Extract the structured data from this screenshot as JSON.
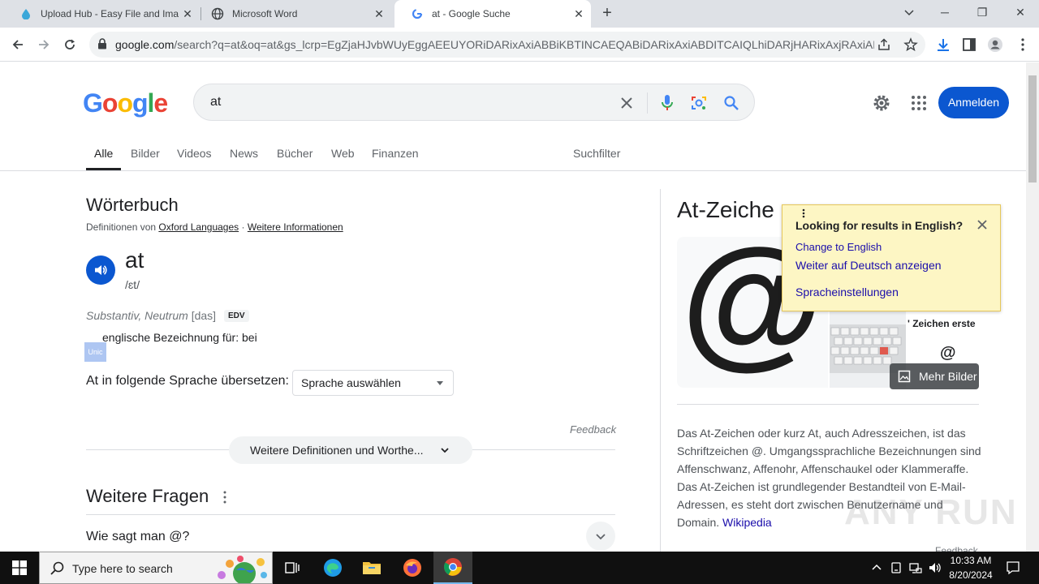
{
  "browser": {
    "tabs": [
      {
        "title": "Upload Hub - Easy File and Imag",
        "active": false
      },
      {
        "title": "Microsoft Word",
        "active": false
      },
      {
        "title": "at - Google Suche",
        "active": true
      }
    ],
    "url_host": "google.com",
    "url_rest": "/search?q=at&oq=at&gs_lcrp=EgZjaHJvbWUyEggAEEUYORiDARixAxiABBiKBTINCAEQABiDARixAxiABDITCAIQLhiDARjHARixAxjRAxiABDINC..."
  },
  "google": {
    "logo_letters": [
      "G",
      "o",
      "o",
      "g",
      "l",
      "e"
    ],
    "logo_colors": [
      "#4285F4",
      "#EA4335",
      "#FBBC05",
      "#4285F4",
      "#34A853",
      "#EA4335"
    ],
    "query": "at",
    "signin_label": "Anmelden",
    "tabs": [
      "Alle",
      "Bilder",
      "Videos",
      "News",
      "Bücher",
      "Web",
      "Finanzen"
    ],
    "filter_label": "Suchfilter"
  },
  "dictionary": {
    "title": "Wörterbuch",
    "source_prefix": "Definitionen von",
    "source_link": "Oxford Languages",
    "separator": "·",
    "more_info": "Weitere Informationen",
    "word": "at",
    "phonetic": "/ɛt/",
    "pos": "Substantiv, Neutrum",
    "gender": "[das]",
    "tag": "EDV",
    "definition": "englische Bezeichnung für: bei",
    "selection_artifact": "Unic",
    "translate_label": "At in folgende Sprache übersetzen:",
    "language_select": "Sprache auswählen",
    "feedback": "Feedback",
    "more_defs": "Weitere Definitionen und Worthe..."
  },
  "faq": {
    "title": "Weitere Fragen",
    "items": [
      "Wie sagt man @?"
    ]
  },
  "knowledge_panel": {
    "title": "At-Zeiche",
    "image3_caption": "' Zeichen erste",
    "image3_symbol": "@",
    "main_symbol": "@",
    "more_images": "Mehr Bilder",
    "description": "Das At-Zeichen oder kurz At, auch Adresszeichen, ist das Schriftzeichen @. Umgangssprachliche Bezeichnungen sind Affenschwanz, Affenohr, Affenschaukel oder Klammeraffe. Das At-Zeichen ist grundlegender Bestandteil von E-Mail-Adressen, es steht dort zwischen Benutzername und Domain. ",
    "source_link": "Wikipedia",
    "feedback": "Feedback"
  },
  "popup": {
    "question": "Looking for results in English?",
    "change_link": "Change to English",
    "stay_link": "Weiter auf Deutsch anzeigen",
    "settings_link": "Spracheinstellungen"
  },
  "watermark": "ANY RUN",
  "taskbar": {
    "search_placeholder": "Type here to search",
    "time": "10:33 AM",
    "date": "8/20/2024"
  }
}
